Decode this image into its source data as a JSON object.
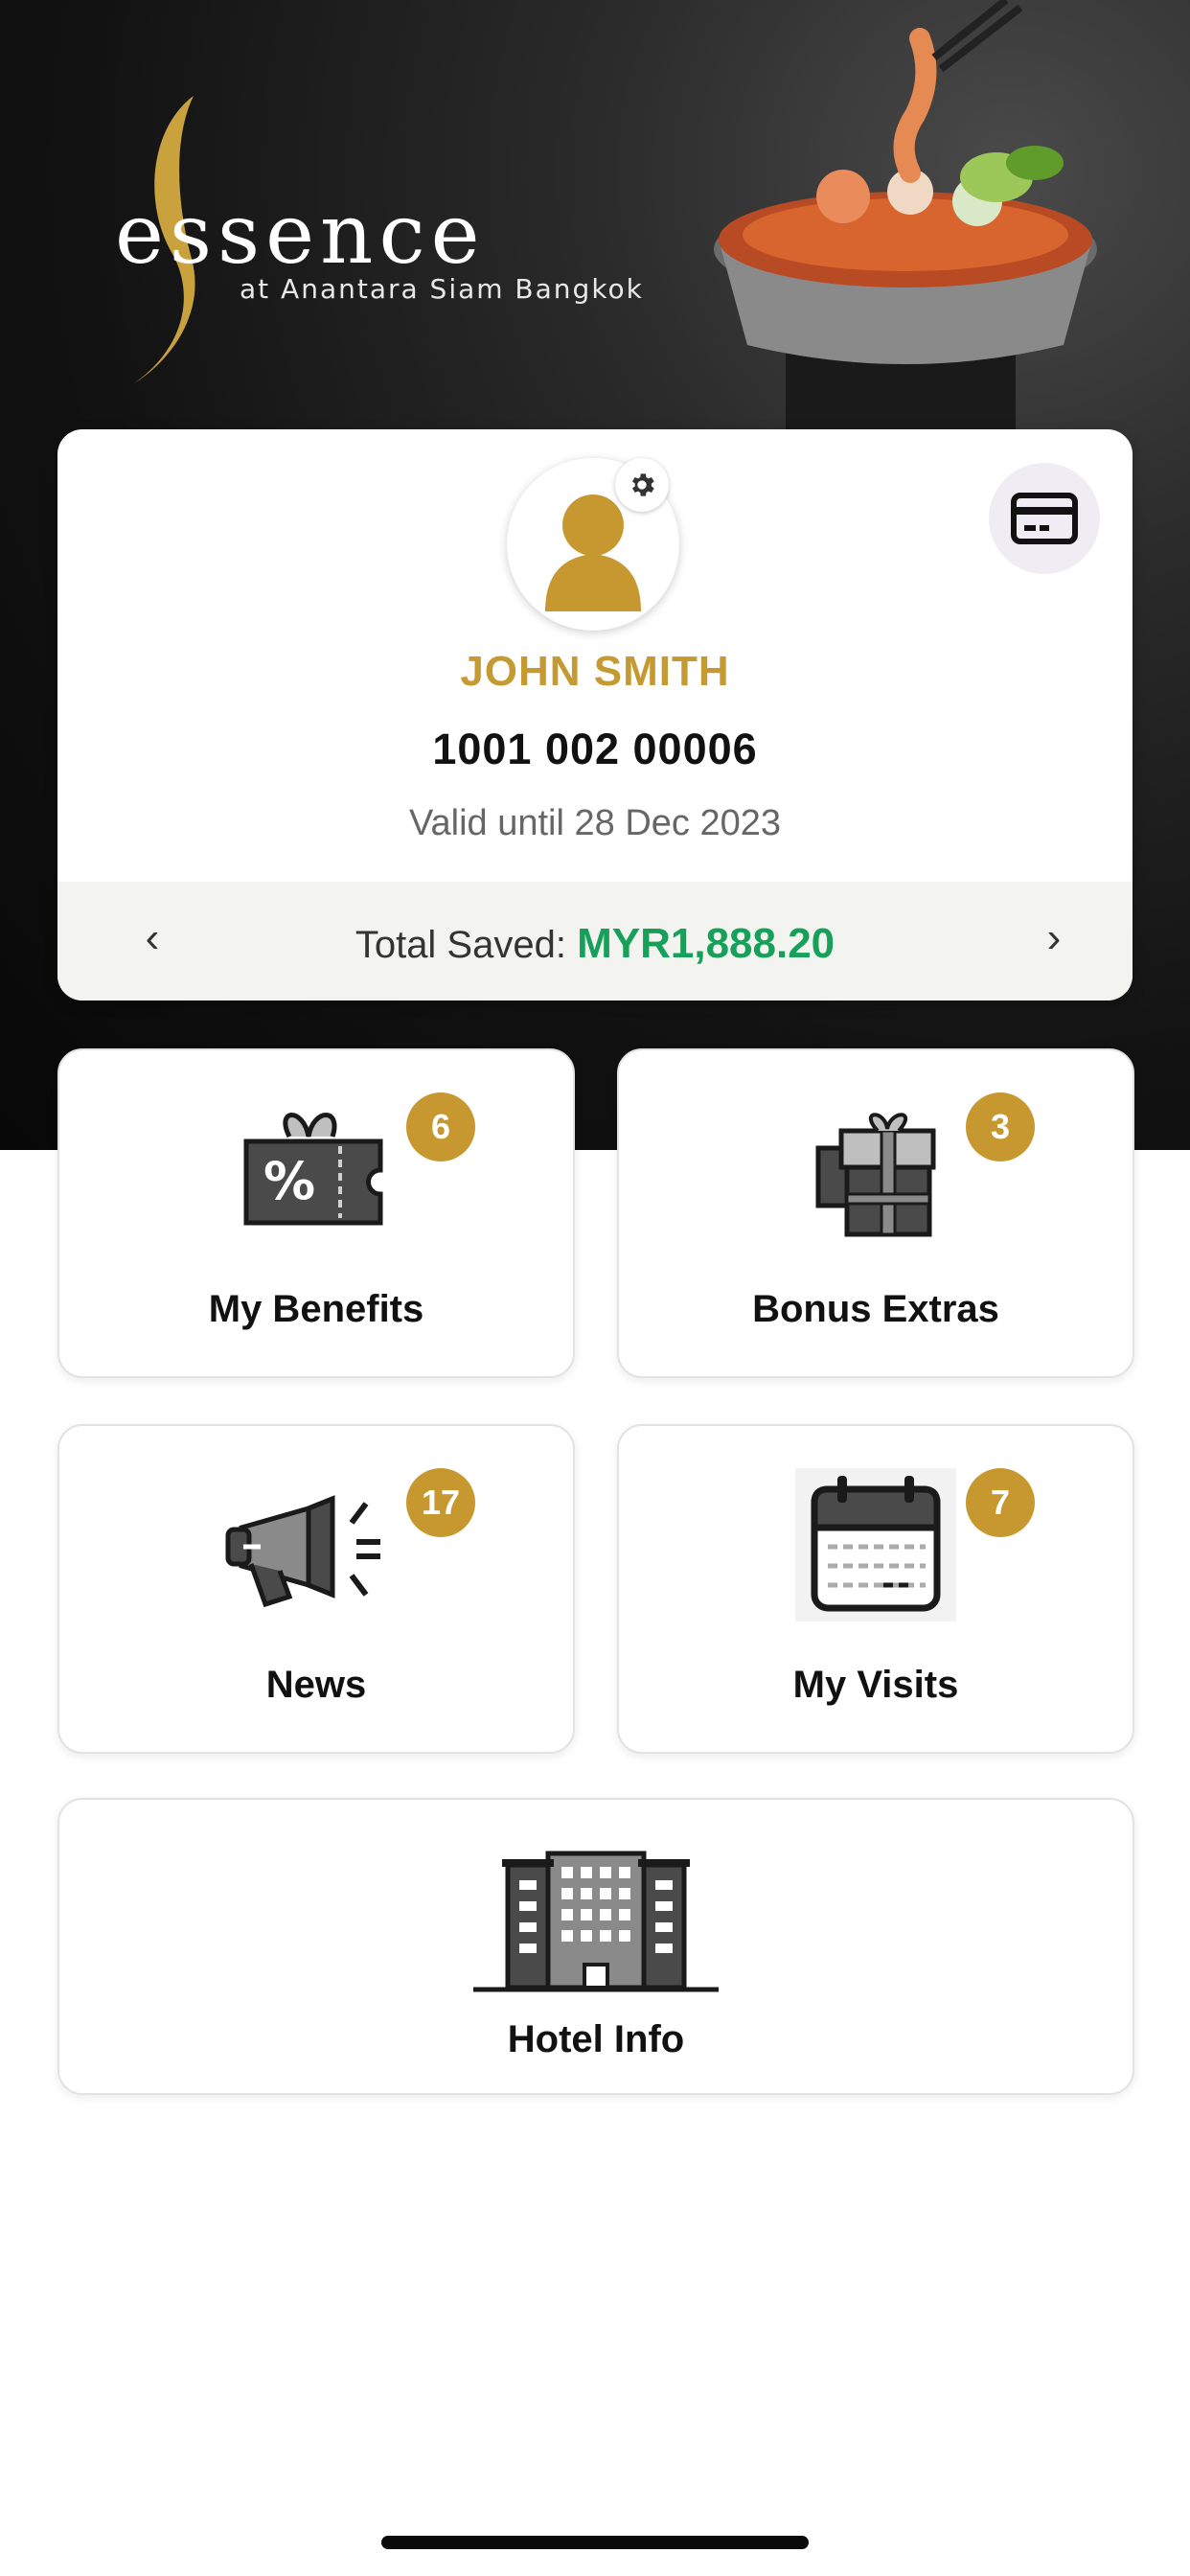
{
  "brand": {
    "wordmark": "essence",
    "subtitle": "at Anantara Siam Bangkok"
  },
  "member": {
    "name": "JOHN SMITH",
    "number": "1001 002 00006",
    "valid": "Valid until 28 Dec 2023",
    "total_saved_label": "Total Saved:",
    "total_saved_value": "MYR1,888.20",
    "prev_arrow": "‹",
    "next_arrow": "›"
  },
  "tiles": [
    {
      "label": "My Benefits",
      "badge": "6",
      "icon": "discount-voucher-icon"
    },
    {
      "label": "Bonus Extras",
      "badge": "3",
      "icon": "gift-icon"
    },
    {
      "label": "News",
      "badge": "17",
      "icon": "megaphone-icon"
    },
    {
      "label": "My Visits",
      "badge": "7",
      "icon": "calendar-icon"
    },
    {
      "label": "Hotel Info",
      "icon": "hotel-building-icon"
    }
  ],
  "colors": {
    "accent_gold": "#c6982f",
    "saved_green": "#17a05a"
  }
}
